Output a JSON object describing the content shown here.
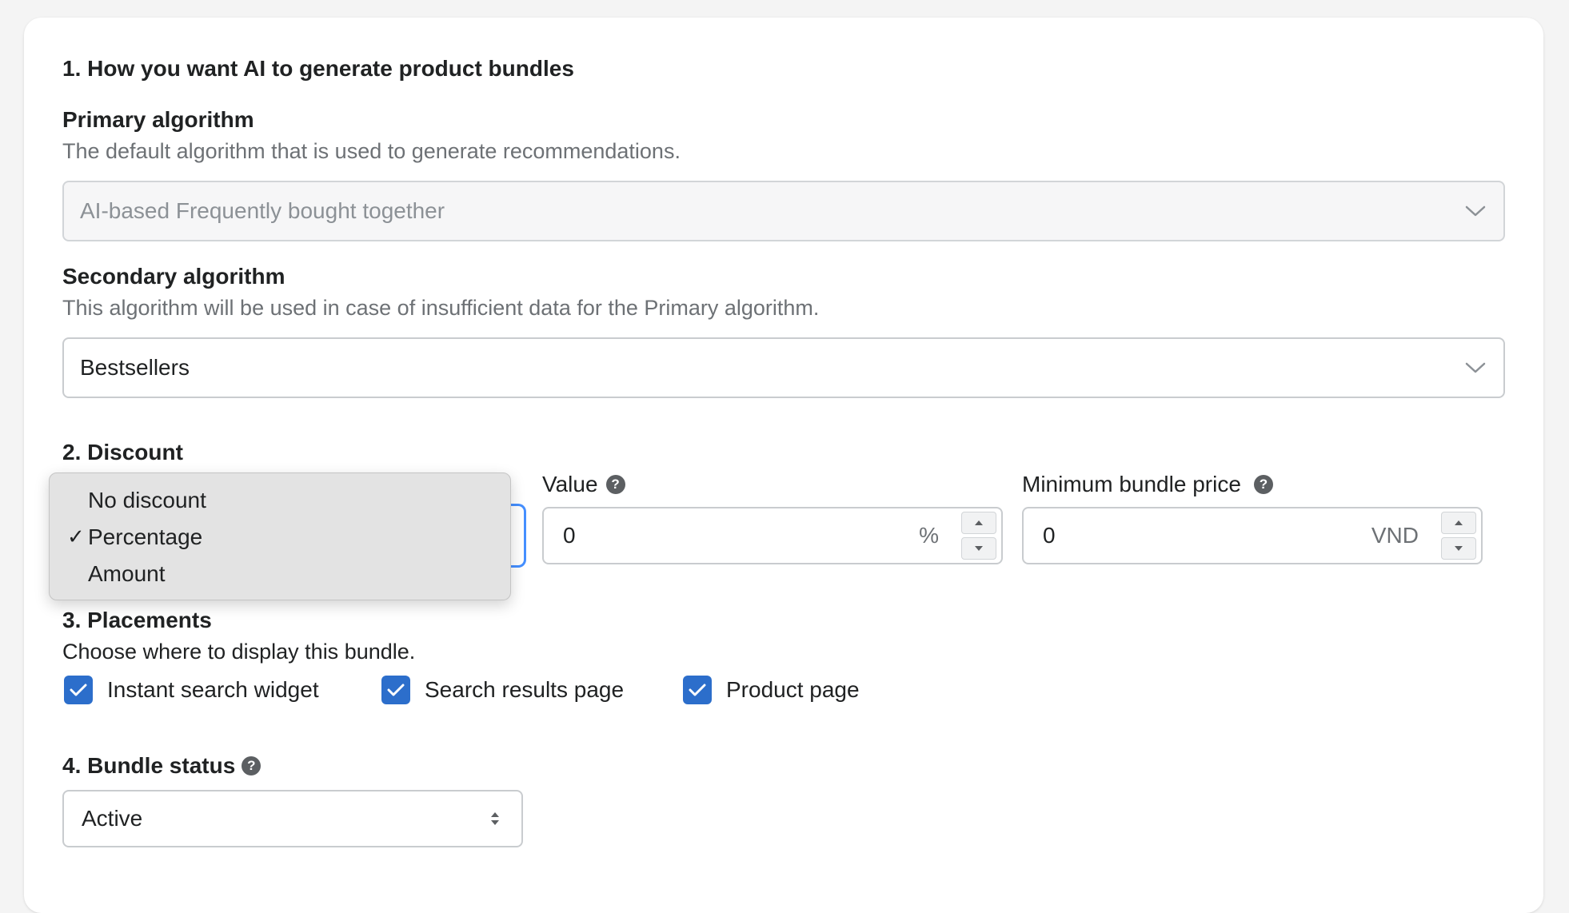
{
  "section1": {
    "title": "1. How you want AI to generate product bundles",
    "primary": {
      "label": "Primary algorithm",
      "help": "The default algorithm that is used to generate recommendations.",
      "value": "AI-based Frequently bought together"
    },
    "secondary": {
      "label": "Secondary algorithm",
      "help": "This algorithm will be used in case of insufficient data for the Primary algorithm.",
      "value": "Bestsellers"
    }
  },
  "section2": {
    "title": "2. Discount",
    "type_options": [
      "No discount",
      "Percentage",
      "Amount"
    ],
    "selected_option": "Percentage",
    "value_label": "Value",
    "value": "0",
    "value_suffix": "%",
    "min_price_label": "Minimum bundle price",
    "min_price": "0",
    "min_price_suffix": "VND"
  },
  "section3": {
    "title": "3. Placements",
    "help": "Choose where to display this bundle.",
    "options": [
      {
        "label": "Instant search widget",
        "checked": true
      },
      {
        "label": "Search results page",
        "checked": true
      },
      {
        "label": "Product page",
        "checked": true
      }
    ]
  },
  "section4": {
    "title": "4. Bundle status",
    "value": "Active"
  },
  "icons": {
    "help": "question-mark-icon",
    "chevron": "chevron-down-icon",
    "check": "checkmark-icon"
  },
  "colors": {
    "accent": "#2c6ecb",
    "focus": "#458fff"
  }
}
